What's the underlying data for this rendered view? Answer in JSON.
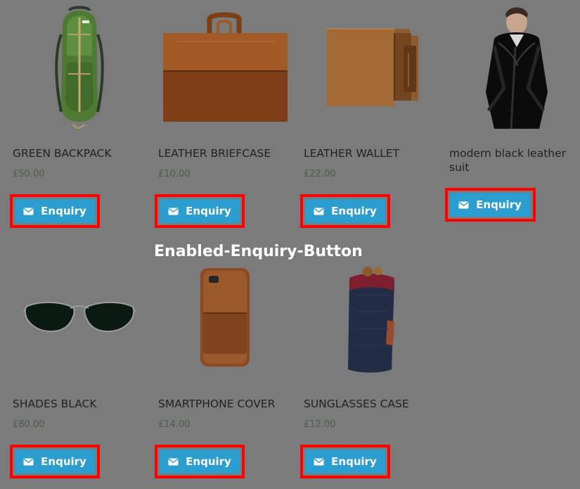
{
  "overlay": {
    "label": "Enabled-Enquiry-Button"
  },
  "products": [
    {
      "title": "GREEN BACKPACK",
      "price": "£50.00",
      "button_label": "Enquiry",
      "icon": "envelope-icon",
      "image": "backpack-image"
    },
    {
      "title": "LEATHER BRIEFCASE",
      "price": "£10.00",
      "button_label": "Enquiry",
      "icon": "envelope-icon",
      "image": "briefcase-image"
    },
    {
      "title": "LEATHER WALLET",
      "price": "£22.00",
      "button_label": "Enquiry",
      "icon": "envelope-icon",
      "image": "wallet-image"
    },
    {
      "title": "modern black leather suit",
      "price": "",
      "button_label": "Enquiry",
      "icon": "envelope-icon",
      "image": "jacket-image"
    },
    {
      "title": "SHADES BLACK",
      "price": "£80.00",
      "button_label": "Enquiry",
      "icon": "envelope-icon",
      "image": "sunglasses-image"
    },
    {
      "title": "SMARTPHONE COVER",
      "price": "£14.00",
      "button_label": "Enquiry",
      "icon": "envelope-icon",
      "image": "phone-cover-image"
    },
    {
      "title": "SUNGLASSES CASE",
      "price": "£12.00",
      "button_label": "Enquiry",
      "icon": "envelope-icon",
      "image": "glasses-case-image"
    }
  ],
  "colors": {
    "page_background": "#7b7b7b",
    "button_blue": "#2b9dcf",
    "highlight_red": "#ff0000",
    "title_text": "#222222",
    "price_text": "#4f5d4a"
  }
}
